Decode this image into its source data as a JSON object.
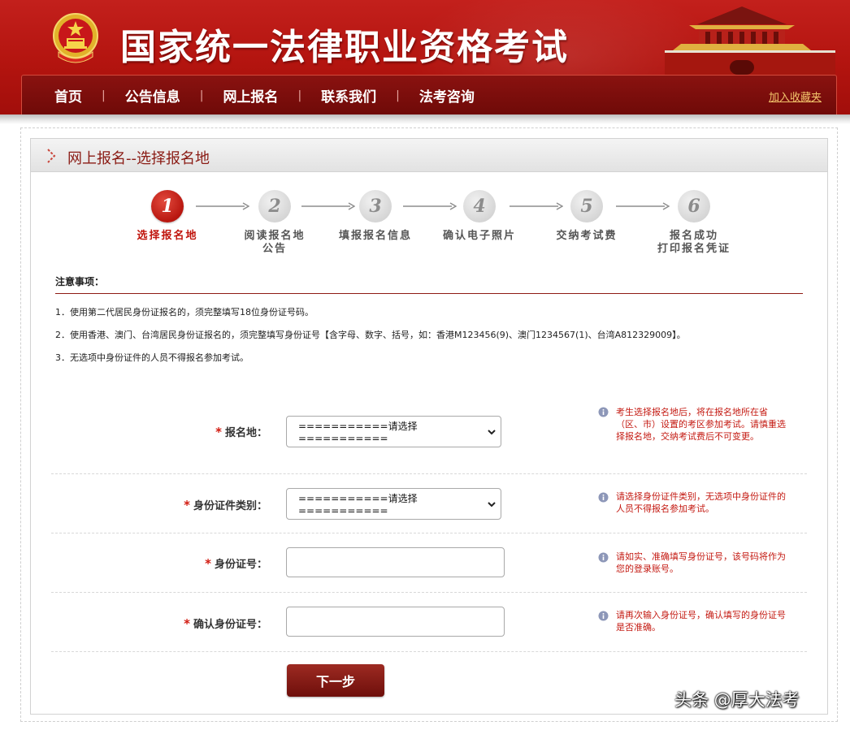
{
  "header": {
    "site_title": "国家统一法律职业资格考试",
    "nav": [
      "首页",
      "公告信息",
      "网上报名",
      "联系我们",
      "法考咨询"
    ],
    "nav_separator": "|",
    "favorite_link": "加入收藏夹"
  },
  "panel": {
    "title": "网上报名--选择报名地"
  },
  "steps": [
    {
      "number": "1",
      "label": "选择报名地",
      "active": true
    },
    {
      "number": "2",
      "label": "阅读报名地公告",
      "label_line1": "阅读报名地",
      "label_line2": "公告",
      "active": false
    },
    {
      "number": "3",
      "label": "填报报名信息",
      "active": false
    },
    {
      "number": "4",
      "label": "确认电子照片",
      "active": false
    },
    {
      "number": "5",
      "label": "交纳考试费",
      "active": false
    },
    {
      "number": "6",
      "label": "报名成功打印报名凭证",
      "label_line1": "报名成功",
      "label_line2": "打印报名凭证",
      "active": false
    }
  ],
  "notice": {
    "title": "注意事项：",
    "items": [
      "1．使用第二代居民身份证报名的，须完整填写18位身份证号码。",
      "2．使用香港、澳门、台湾居民身份证报名的，须完整填写身份证号【含字母、数字、括号，如：香港M123456(9)、澳门1234567(1)、台湾A812329009】。",
      "3．无选项中身份证件的人员不得报名参加考试。"
    ]
  },
  "form": {
    "required_mark": "*",
    "fields": [
      {
        "label": "报名地：",
        "type": "select",
        "value": "===========请选择===========",
        "hint": "考生选择报名地后，将在报名地所在省（区、市）设置的考区参加考试。请慎重选择报名地，交纳考试费后不可变更。"
      },
      {
        "label": "身份证件类别：",
        "type": "select",
        "value": "===========请选择===========",
        "hint": "请选择身份证件类别，无选项中身份证件的人员不得报名参加考试。"
      },
      {
        "label": "身份证号：",
        "type": "text",
        "value": "",
        "hint": "请如实、准确填写身份证号，该号码将作为您的登录账号。"
      },
      {
        "label": "确认身份证号：",
        "type": "text",
        "value": "",
        "hint": "请再次输入身份证号，确认填写的身份证号是否准确。"
      }
    ],
    "next_button": "下一步"
  },
  "watermark": "头条 @厚大法考",
  "colors": {
    "brand_red": "#b3140f",
    "nav_dark": "#7a0d0a",
    "hint_red": "#c41a12",
    "title_red": "#8a1b14"
  },
  "icons": {
    "emblem": "national-emblem-icon",
    "gate": "tiananmen-gate-icon",
    "panel": "chevron-right-icon",
    "hint": "info-icon",
    "select": "chevron-down-icon"
  }
}
